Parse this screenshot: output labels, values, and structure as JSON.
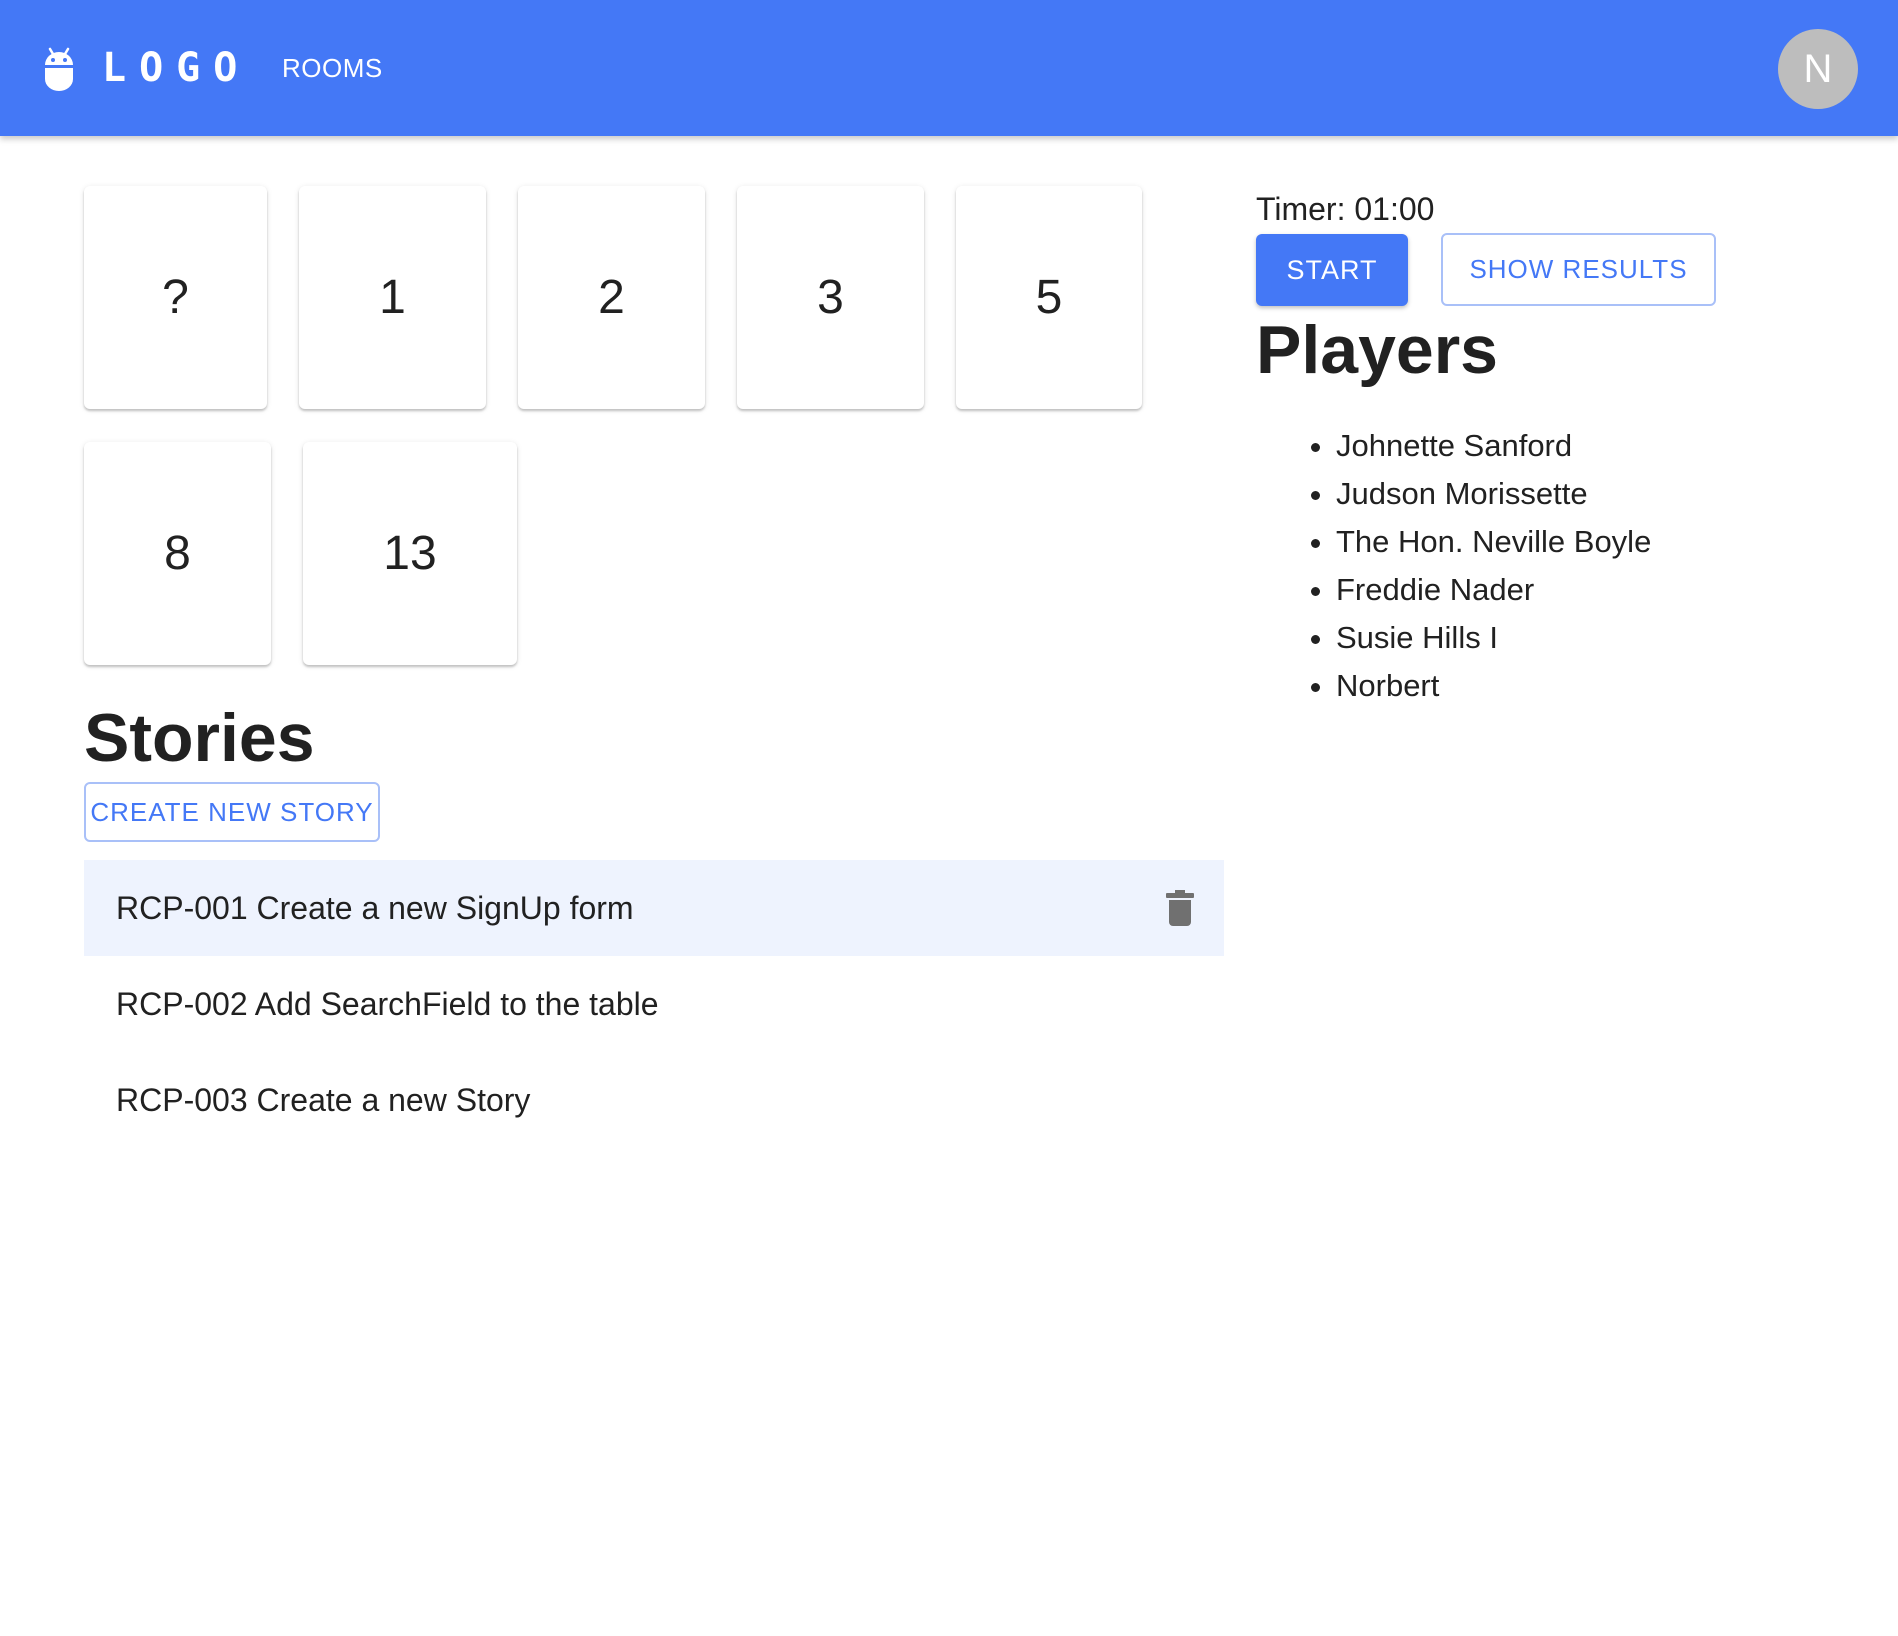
{
  "header": {
    "logo_text": "LOGO",
    "logo_icon": "android-icon",
    "nav_rooms": "ROOMS",
    "avatar_initial": "N"
  },
  "cards": [
    "?",
    "1",
    "2",
    "3",
    "5",
    "8",
    "13"
  ],
  "stories": {
    "title": "Stories",
    "create_button": "CREATE NEW STORY",
    "items": [
      "RCP-001 Create a new SignUp form",
      "RCP-002 Add SearchField to the table",
      "RCP-003 Create a new Story"
    ],
    "delete_icon": "trash-icon"
  },
  "timer": {
    "text": "Timer: 01:00"
  },
  "controls": {
    "start_label": "START",
    "show_results_label": "SHOW RESULTS"
  },
  "players": {
    "title": "Players",
    "items": [
      "Johnette Sanford",
      "Judson Morissette",
      "The Hon. Neville Boyle",
      "Freddie Nader",
      "Susie Hills I",
      "Norbert"
    ]
  },
  "colors": {
    "primary": "#4478f6",
    "selected_row": "#eef3fe",
    "avatar_bg": "#bdbdbd",
    "outline_border": "#a9c0f8"
  }
}
